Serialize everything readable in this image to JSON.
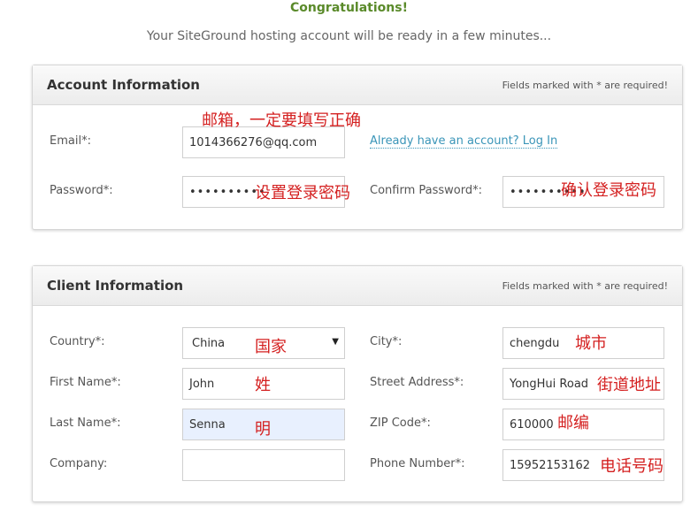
{
  "header": {
    "congrats": "Congratulations!",
    "subtitle": "Your SiteGround hosting account will be ready in a few minutes..."
  },
  "account": {
    "title": "Account Information",
    "note": "Fields marked with * are required!",
    "email_label": "Email*:",
    "email_value": "1014366276@qq.com",
    "login_link": "Already have an account? Log In",
    "password_label": "Password*:",
    "password_value": "••••••••••",
    "confirm_label": "Confirm Password*:",
    "confirm_value": "••••••••••"
  },
  "client": {
    "title": "Client Information",
    "note": "Fields marked with * are required!",
    "country_label": "Country*:",
    "country_value": "China",
    "city_label": "City*:",
    "city_value": "chengdu",
    "first_label": "First Name*:",
    "first_value": "John",
    "street_label": "Street Address*:",
    "street_value": "YongHui Road",
    "last_label": "Last Name*:",
    "last_value": "Senna",
    "zip_label": "ZIP Code*:",
    "zip_value": "610000",
    "company_label": "Company:",
    "company_value": "",
    "phone_label": "Phone Number*:",
    "phone_value": "15952153162"
  },
  "annotations": {
    "email": "邮箱，一定要填写正确",
    "password": "设置登录密码",
    "confirm": "确认登录密码",
    "country": "国家",
    "city": "城市",
    "first": "姓",
    "street": "街道地址",
    "last": "明",
    "zip": "邮编",
    "phone": "电话号码"
  },
  "colors": {
    "accent_green": "#5a8a2a",
    "link_blue": "#3a95b8",
    "annotation_red": "#d42020"
  }
}
